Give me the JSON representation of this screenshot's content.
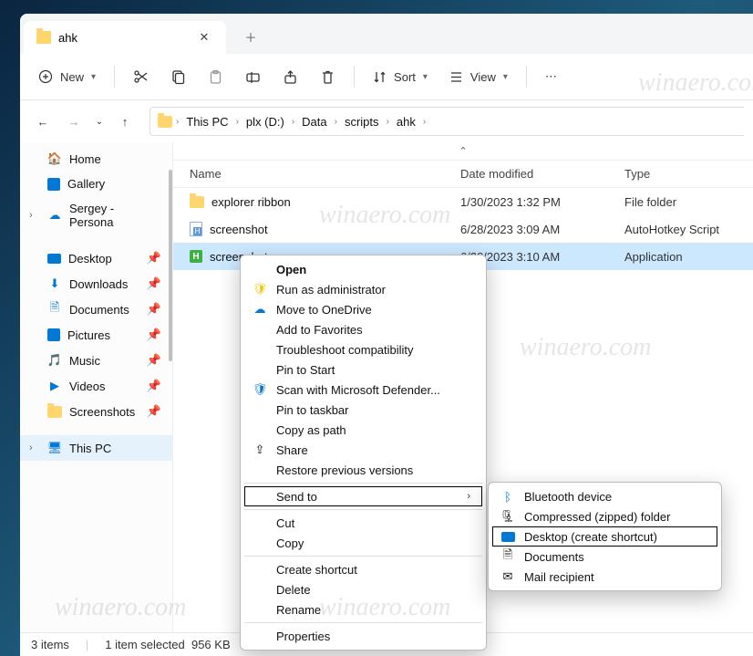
{
  "tab": {
    "title": "ahk"
  },
  "toolbar": {
    "new": "New",
    "sort": "Sort",
    "view": "View"
  },
  "breadcrumb": [
    "This PC",
    "plx (D:)",
    "Data",
    "scripts",
    "ahk"
  ],
  "sidebar": {
    "top": [
      {
        "label": "Home",
        "icon": "home"
      },
      {
        "label": "Gallery",
        "icon": "gallery"
      },
      {
        "label": "Sergey - Persona",
        "icon": "onedrive",
        "chev": true
      }
    ],
    "pinned": [
      {
        "label": "Desktop",
        "icon": "desktop"
      },
      {
        "label": "Downloads",
        "icon": "downloads"
      },
      {
        "label": "Documents",
        "icon": "documents"
      },
      {
        "label": "Pictures",
        "icon": "pictures"
      },
      {
        "label": "Music",
        "icon": "music"
      },
      {
        "label": "Videos",
        "icon": "videos"
      },
      {
        "label": "Screenshots",
        "icon": "folder"
      }
    ],
    "thispc": "This PC"
  },
  "columns": {
    "name": "Name",
    "date": "Date modified",
    "type": "Type"
  },
  "rows": [
    {
      "name": "explorer ribbon",
      "date": "1/30/2023 1:32 PM",
      "type": "File folder",
      "icon": "folder"
    },
    {
      "name": "screenshot",
      "date": "6/28/2023 3:09 AM",
      "type": "AutoHotkey Script",
      "icon": "ahk"
    },
    {
      "name": "screenshot",
      "date": "6/28/2023 3:10 AM",
      "type": "Application",
      "icon": "app",
      "selected": true
    }
  ],
  "status": {
    "items": "3 items",
    "selected": "1 item selected",
    "size": "956 KB"
  },
  "ctx": {
    "open": "Open",
    "runas": "Run as administrator",
    "onedrive": "Move to OneDrive",
    "fav": "Add to Favorites",
    "compat": "Troubleshoot compatibility",
    "pinstart": "Pin to Start",
    "defender": "Scan with Microsoft Defender...",
    "pintask": "Pin to taskbar",
    "copypath": "Copy as path",
    "share": "Share",
    "restore": "Restore previous versions",
    "sendto": "Send to",
    "cut": "Cut",
    "copy": "Copy",
    "shortcut": "Create shortcut",
    "delete": "Delete",
    "rename": "Rename",
    "props": "Properties"
  },
  "sendto": {
    "bt": "Bluetooth device",
    "zip": "Compressed (zipped) folder",
    "desk": "Desktop (create shortcut)",
    "docs": "Documents",
    "mail": "Mail recipient"
  }
}
